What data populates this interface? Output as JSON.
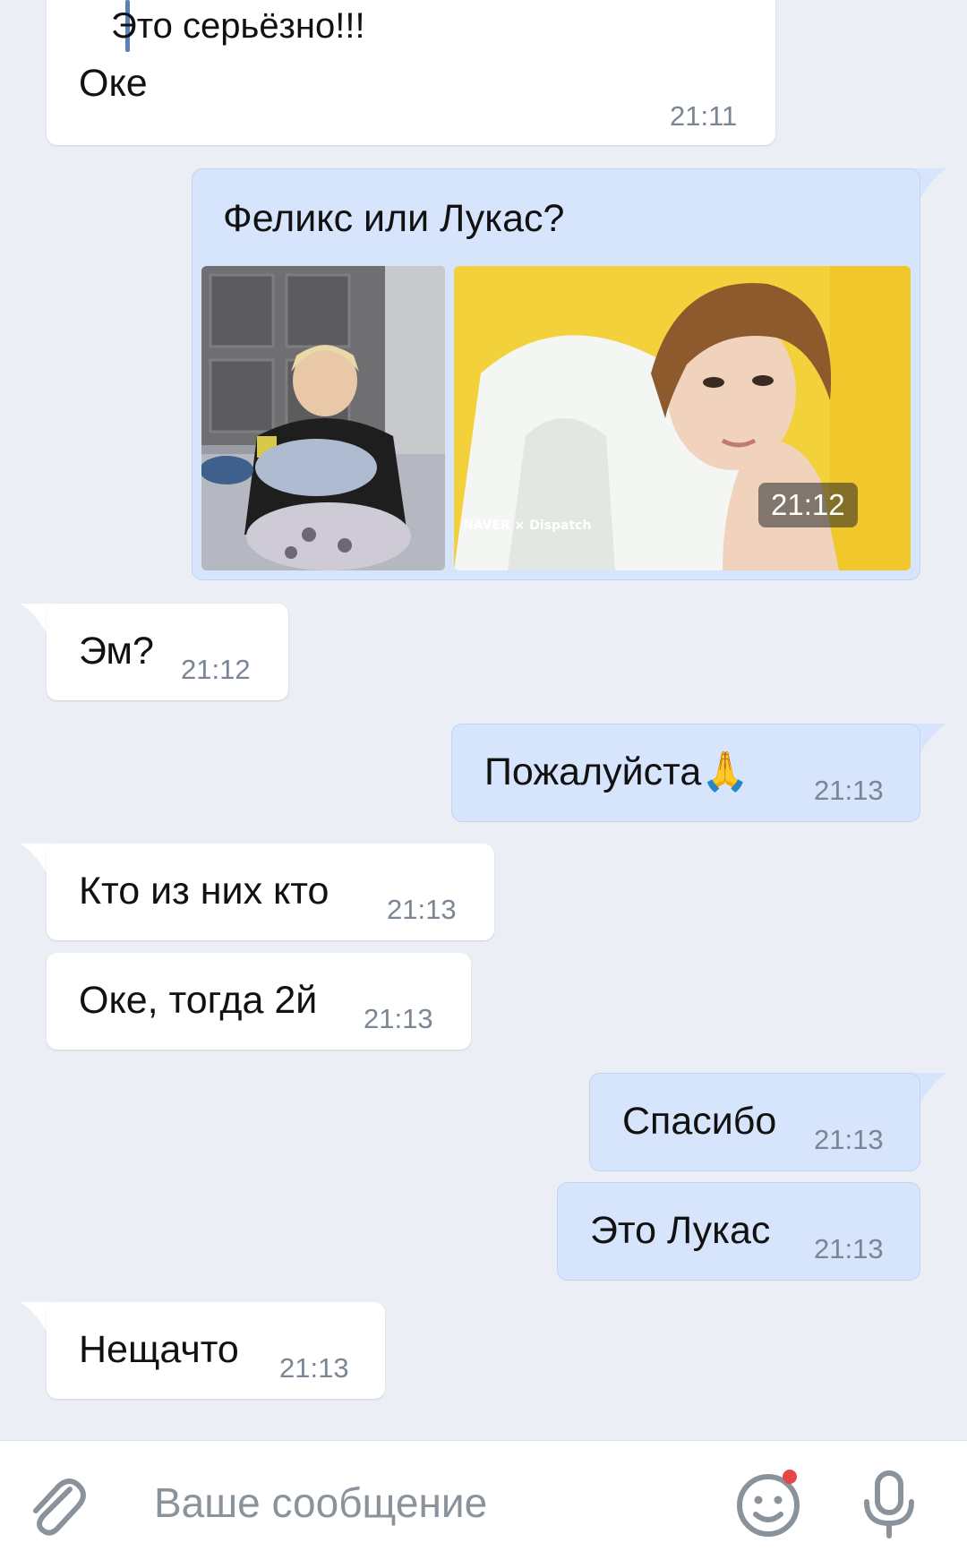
{
  "messages": [
    {
      "quote": "Это серьёзно!!!",
      "text": "Оке",
      "time": "21:11"
    },
    {
      "text": "Феликс или Лукас?",
      "time": "21:12"
    },
    {
      "text": "Эм?",
      "time": "21:12"
    },
    {
      "text": "Пожалуйста🙏",
      "time": "21:13"
    },
    {
      "text": "Кто из них кто",
      "time": "21:13"
    },
    {
      "text": "Оке, тогда 2й",
      "time": "21:13"
    },
    {
      "text": "Спасибо",
      "time": "21:13"
    },
    {
      "text": "Это Лукас",
      "time": "21:13"
    },
    {
      "text": "Нещачто",
      "time": "21:13"
    }
  ],
  "photo_watermark": "NAVER × Dispatch",
  "composer": {
    "placeholder": "Ваше сообщение",
    "icons": [
      "paperclip-icon",
      "emoji-icon",
      "microphone-icon"
    ]
  },
  "colors": {
    "background": "#ebeef5",
    "incoming_bubble": "#ffffff",
    "outgoing_bubble": "#d6e5fb",
    "quote_bar": "#5a81b5",
    "time_text": "#7b8694",
    "notification_dot": "#e64646"
  }
}
